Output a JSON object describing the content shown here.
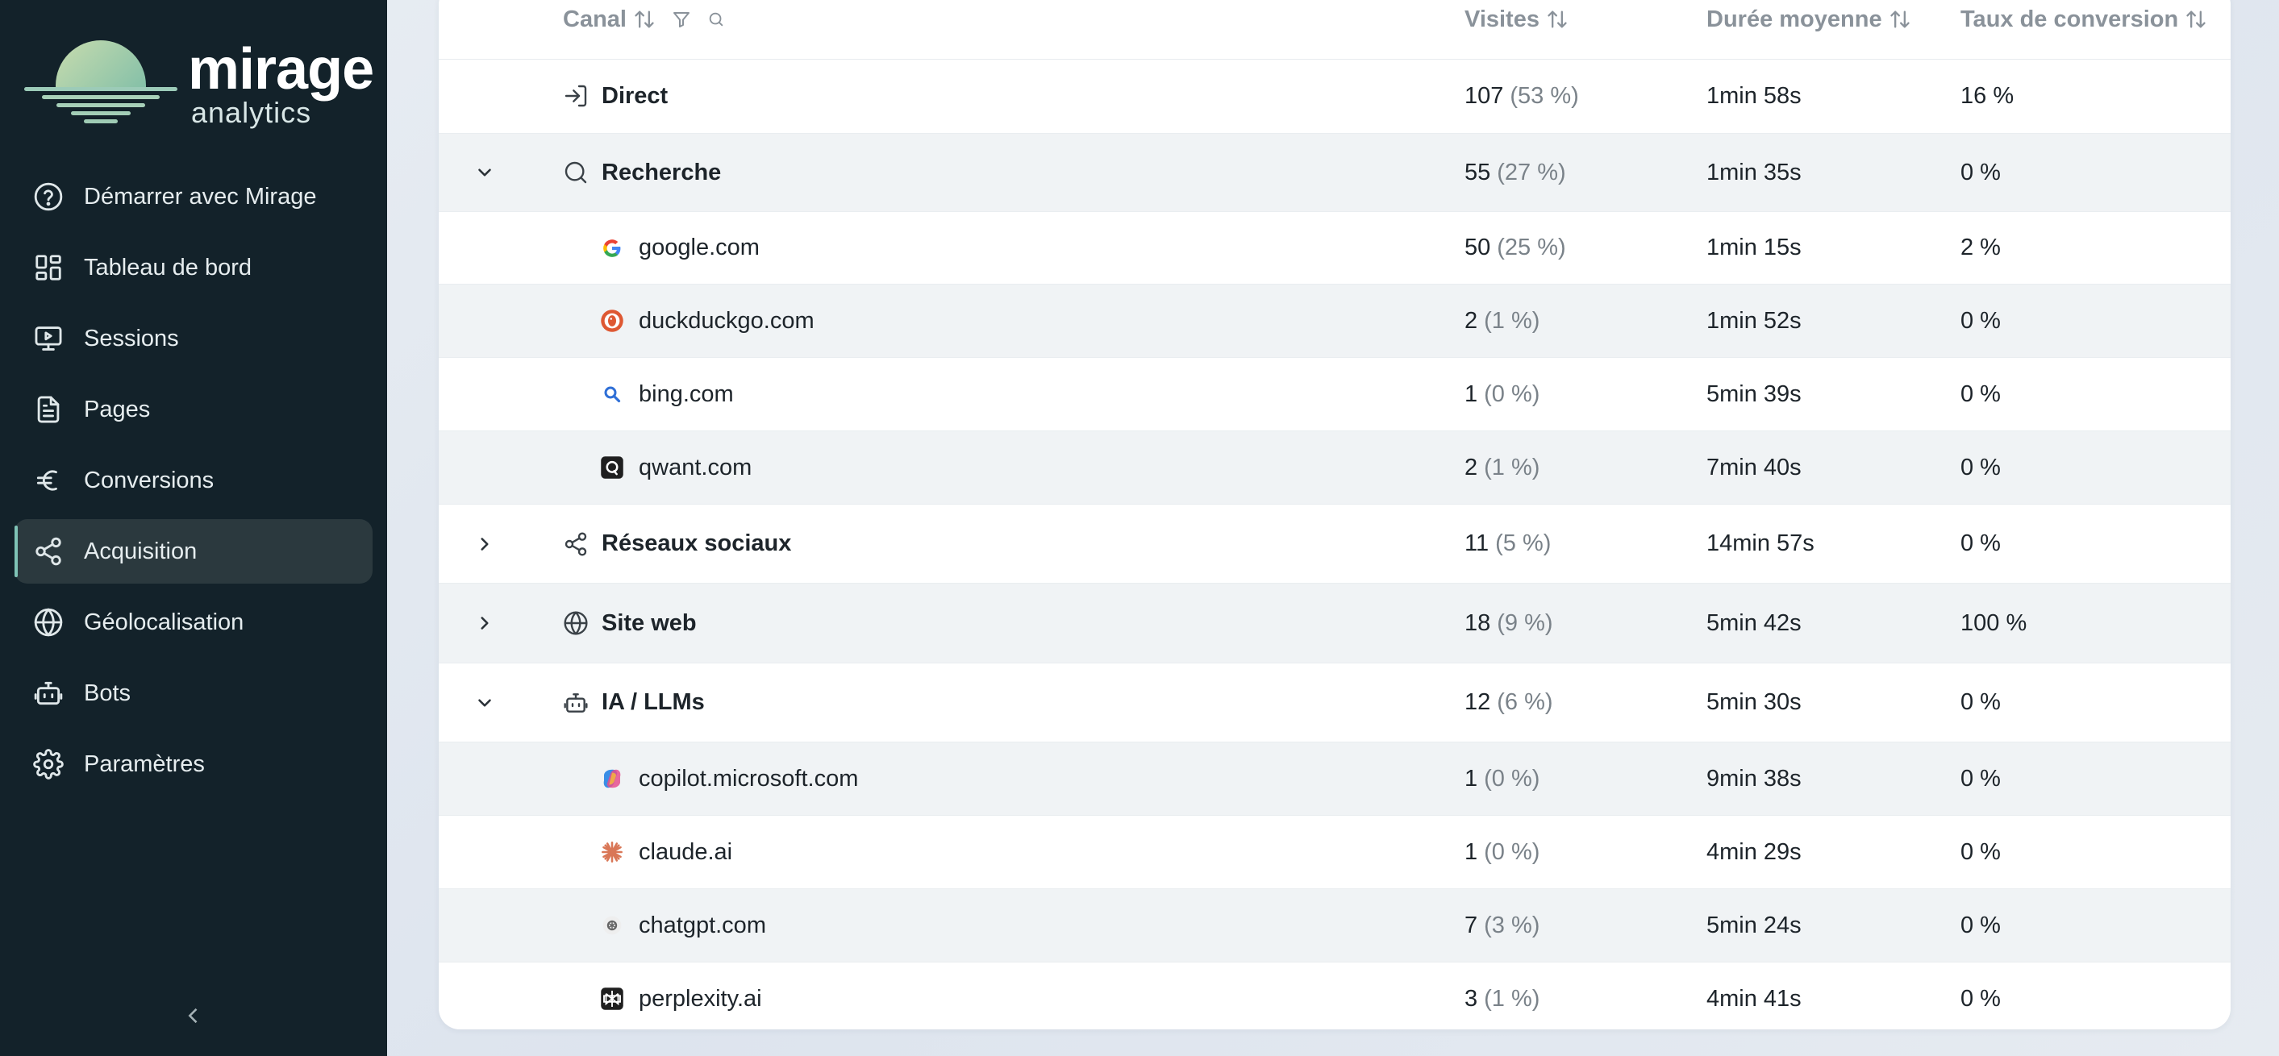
{
  "brand": {
    "name": "mirage",
    "tagline": "analytics"
  },
  "sidebar": {
    "items": [
      {
        "label": "Démarrer avec Mirage",
        "icon": "help-circle-icon",
        "active": false
      },
      {
        "label": "Tableau de bord",
        "icon": "dashboard-icon",
        "active": false
      },
      {
        "label": "Sessions",
        "icon": "monitor-play-icon",
        "active": false
      },
      {
        "label": "Pages",
        "icon": "document-icon",
        "active": false
      },
      {
        "label": "Conversions",
        "icon": "euro-icon",
        "active": false
      },
      {
        "label": "Acquisition",
        "icon": "share-icon",
        "active": true
      },
      {
        "label": "Géolocalisation",
        "icon": "globe-icon",
        "active": false
      },
      {
        "label": "Bots",
        "icon": "bot-icon",
        "active": false
      },
      {
        "label": "Paramètres",
        "icon": "gear-icon",
        "active": false
      }
    ],
    "collapse_icon": "chevron-left-icon"
  },
  "table": {
    "headers": {
      "channel": "Canal",
      "visits": "Visites",
      "duration": "Durée moyenne",
      "conversion": "Taux de conversion"
    },
    "rows": [
      {
        "kind": "parent",
        "label": "Direct",
        "icon": "login-icon",
        "expand": "none",
        "visits": "107",
        "visits_pct": "(53 %)",
        "duration": "1min 58s",
        "conversion": "16 %"
      },
      {
        "kind": "parent",
        "label": "Recherche",
        "icon": "search-icon",
        "expand": "expanded",
        "visits": "55",
        "visits_pct": "(27 %)",
        "duration": "1min 35s",
        "conversion": "0 %"
      },
      {
        "kind": "child",
        "label": "google.com",
        "icon": "google-favicon",
        "visits": "50",
        "visits_pct": "(25 %)",
        "duration": "1min 15s",
        "conversion": "2 %"
      },
      {
        "kind": "child",
        "label": "duckduckgo.com",
        "icon": "duckduckgo-favicon",
        "visits": "2",
        "visits_pct": "(1 %)",
        "duration": "1min 52s",
        "conversion": "0 %"
      },
      {
        "kind": "child",
        "label": "bing.com",
        "icon": "bing-favicon",
        "visits": "1",
        "visits_pct": "(0 %)",
        "duration": "5min 39s",
        "conversion": "0 %"
      },
      {
        "kind": "child",
        "label": "qwant.com",
        "icon": "qwant-favicon",
        "visits": "2",
        "visits_pct": "(1 %)",
        "duration": "7min 40s",
        "conversion": "0 %"
      },
      {
        "kind": "parent",
        "label": "Réseaux sociaux",
        "icon": "share-icon",
        "expand": "collapsed",
        "visits": "11",
        "visits_pct": "(5 %)",
        "duration": "14min 57s",
        "conversion": "0 %"
      },
      {
        "kind": "parent",
        "label": "Site web",
        "icon": "globe-icon",
        "expand": "collapsed",
        "visits": "18",
        "visits_pct": "(9 %)",
        "duration": "5min 42s",
        "conversion": "100 %"
      },
      {
        "kind": "parent",
        "label": "IA / LLMs",
        "icon": "bot-icon",
        "expand": "expanded",
        "visits": "12",
        "visits_pct": "(6 %)",
        "duration": "5min 30s",
        "conversion": "0 %"
      },
      {
        "kind": "child",
        "label": "copilot.microsoft.com",
        "icon": "copilot-favicon",
        "visits": "1",
        "visits_pct": "(0 %)",
        "duration": "9min 38s",
        "conversion": "0 %"
      },
      {
        "kind": "child",
        "label": "claude.ai",
        "icon": "claude-favicon",
        "visits": "1",
        "visits_pct": "(0 %)",
        "duration": "4min 29s",
        "conversion": "0 %"
      },
      {
        "kind": "child",
        "label": "chatgpt.com",
        "icon": "chatgpt-favicon",
        "visits": "7",
        "visits_pct": "(3 %)",
        "duration": "5min 24s",
        "conversion": "0 %"
      },
      {
        "kind": "child",
        "label": "perplexity.ai",
        "icon": "perplexity-favicon",
        "visits": "3",
        "visits_pct": "(1 %)",
        "duration": "4min 41s",
        "conversion": "0 %"
      }
    ]
  },
  "colors": {
    "sidebar_bg": "#13222a",
    "active_item_bg": "#2b393e",
    "active_accent": "#7fc3b6",
    "row_alt_bg": "#f0f3f5"
  }
}
